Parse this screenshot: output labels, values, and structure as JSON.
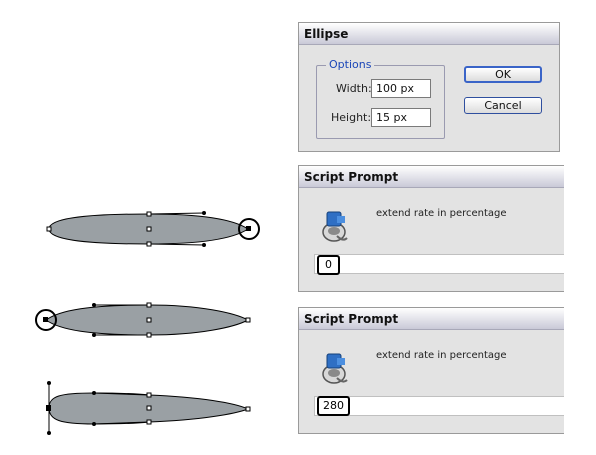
{
  "ellipse_dialog": {
    "title": "Ellipse",
    "options_legend": "Options",
    "width_label": "Width:",
    "width_value": "100 px",
    "height_label": "Height:",
    "height_value": "15 px",
    "ok_label": "OK",
    "cancel_label": "Cancel"
  },
  "script_prompts": [
    {
      "title": "Script Prompt",
      "message": "extend rate in percentage",
      "value": "0"
    },
    {
      "title": "Script Prompt",
      "message": "extend rate in percentage",
      "value": "280"
    }
  ],
  "colors": {
    "shape_fill": "#9aa0a4",
    "title_gradient_end": "#c9c9d7",
    "dialog_bg": "#e3e3e3",
    "legend_blue": "#1a46b8"
  },
  "icons": [
    "script-icon",
    "anchor-point-icon",
    "circle-marker-icon"
  ]
}
